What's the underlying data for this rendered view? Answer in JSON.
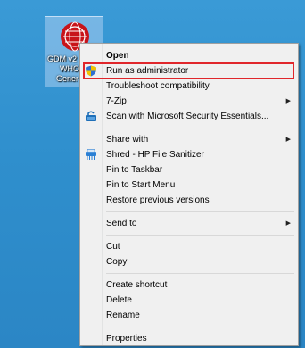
{
  "desktop": {
    "icon": {
      "label_lines": [
        "GDM v2",
        "WHO",
        "Gener"
      ]
    }
  },
  "context_menu": {
    "items": [
      {
        "label": "Open"
      },
      {
        "label": "Run as administrator"
      },
      {
        "label": "Troubleshoot compatibility"
      },
      {
        "label": "7-Zip"
      },
      {
        "label": "Scan with Microsoft Security Essentials..."
      },
      {
        "label": "Share with"
      },
      {
        "label": "Shred - HP File Sanitizer"
      },
      {
        "label": "Pin to Taskbar"
      },
      {
        "label": "Pin to Start Menu"
      },
      {
        "label": "Restore previous versions"
      },
      {
        "label": "Send to"
      },
      {
        "label": "Cut"
      },
      {
        "label": "Copy"
      },
      {
        "label": "Create shortcut"
      },
      {
        "label": "Delete"
      },
      {
        "label": "Rename"
      },
      {
        "label": "Properties"
      }
    ],
    "submenu_arrow": "▶"
  },
  "colors": {
    "desktop_background": "#2f8fcd",
    "menu_background": "#f0f0f0",
    "highlight_border": "#e0262b"
  }
}
